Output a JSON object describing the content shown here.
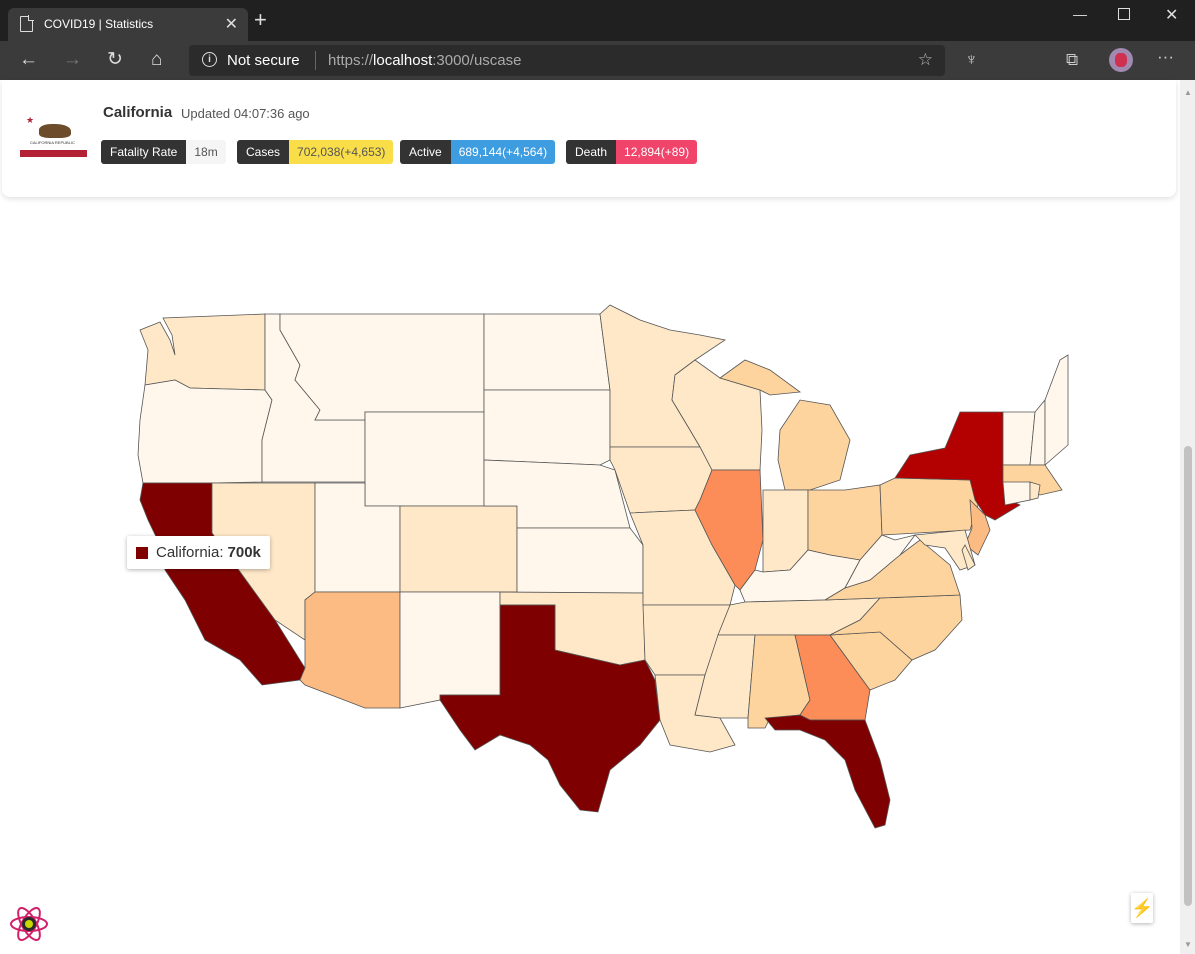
{
  "browser": {
    "tab_title": "COVID19 | Statistics",
    "security_label": "Not secure",
    "url_prefix": "https://",
    "url_host": "localhost",
    "url_rest": ":3000/uscase"
  },
  "header": {
    "state": "California",
    "updated": "Updated 04:07:36 ago",
    "flag_text": "CALIFORNIA REPUBLIC",
    "badges": [
      {
        "key": "Fatality Rate",
        "value": "18m",
        "color": "#f5f5f5",
        "text_color": "#555555"
      },
      {
        "key": "Cases",
        "value": "702,038(+4,653)",
        "color": "#f9de4a",
        "text_color": "#555555"
      },
      {
        "key": "Active",
        "value": "689,144(+4,564)",
        "color": "#3d9de0",
        "text_color": "#ffffff"
      },
      {
        "key": "Death",
        "value": "12,894(+89)",
        "color": "#f0446b",
        "text_color": "#ffffff"
      }
    ]
  },
  "tooltip": {
    "label": "California:",
    "value": "700k",
    "color": "#800000"
  },
  "map_colors": {
    "level_0": "#fff7ec",
    "level_1": "#fee8c8",
    "level_2": "#fdd49e",
    "level_3": "#fdbb84",
    "level_4": "#fc8d59",
    "level_5": "#b30000",
    "level_6": "#7f0000"
  },
  "icons": {
    "back": "arrow-left-icon",
    "forward": "arrow-right-icon",
    "refresh": "refresh-icon",
    "home": "home-icon",
    "favorite": "star-icon",
    "collections": "collections-icon",
    "more": "more-icon",
    "lightning": "lightning-icon",
    "react": "react-logo-icon"
  }
}
